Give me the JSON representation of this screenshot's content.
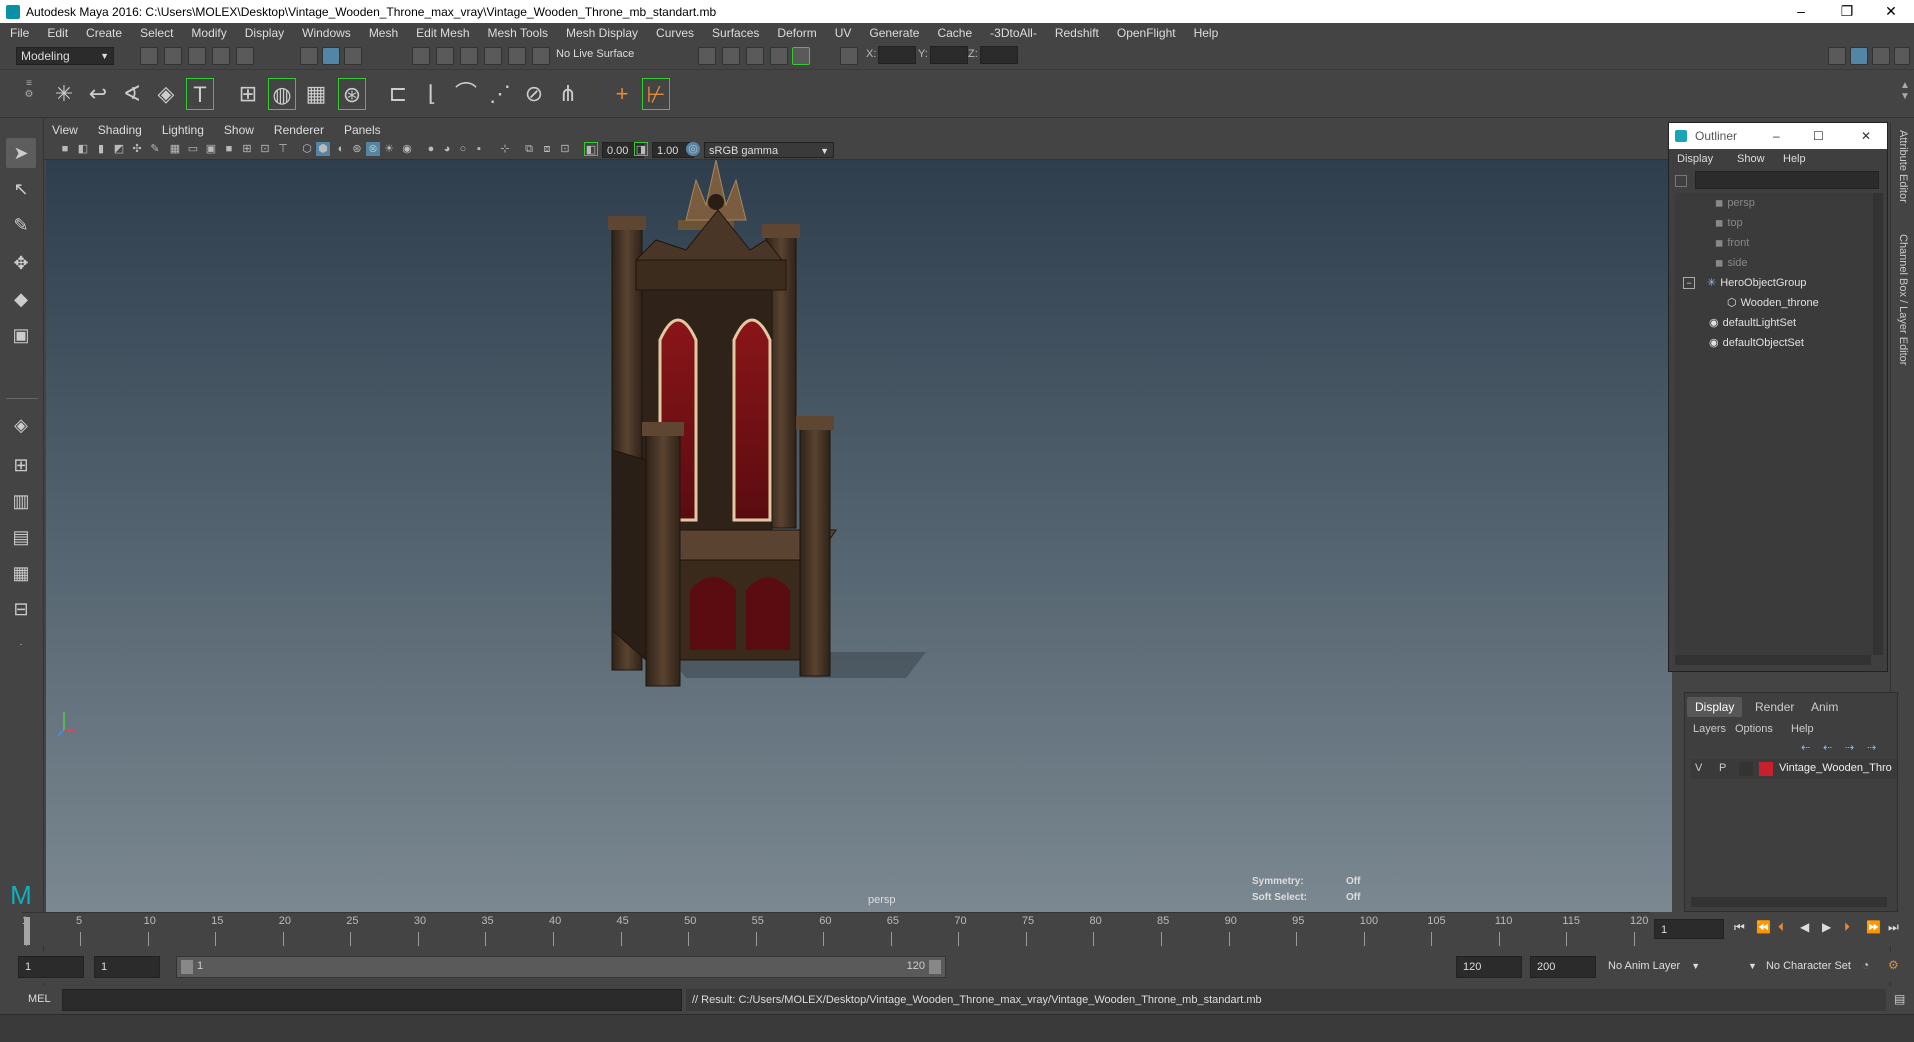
{
  "window": {
    "title": "Autodesk Maya 2016: C:\\Users\\MOLEX\\Desktop\\Vintage_Wooden_Throne_max_vray\\Vintage_Wooden_Throne_mb_standart.mb",
    "controls": [
      "–",
      "❐",
      "✕"
    ]
  },
  "menubar": [
    "File",
    "Edit",
    "Create",
    "Select",
    "Modify",
    "Display",
    "Windows",
    "Mesh",
    "Edit Mesh",
    "Mesh Tools",
    "Mesh Display",
    "Curves",
    "Surfaces",
    "Deform",
    "UV",
    "Generate",
    "Cache",
    "-3DtoAll-",
    "Redshift",
    "OpenFlight",
    "Help"
  ],
  "status_line": {
    "mode": "Modeling",
    "live_surface": "No Live Surface",
    "coord_labels": [
      "X:",
      "Y:",
      "Z:"
    ]
  },
  "viewport": {
    "menu": [
      "View",
      "Shading",
      "Lighting",
      "Show",
      "Renderer",
      "Panels"
    ],
    "exposure": "0.00",
    "gamma": "1.00",
    "color_space": "sRGB gamma",
    "camera_label": "persp",
    "hud": [
      {
        "label": "Symmetry:",
        "value": "Off"
      },
      {
        "label": "Soft Select:",
        "value": "Off"
      }
    ]
  },
  "outliner": {
    "title": "Outliner",
    "menu": [
      "Display",
      "Show",
      "Help"
    ],
    "items": [
      {
        "label": "persp",
        "icon": "camera-icon",
        "dim": true
      },
      {
        "label": "top",
        "icon": "camera-icon",
        "dim": true
      },
      {
        "label": "front",
        "icon": "camera-icon",
        "dim": true
      },
      {
        "label": "side",
        "icon": "camera-icon",
        "dim": true
      },
      {
        "label": "HeroObjectGroup",
        "icon": "group-icon",
        "dim": false
      },
      {
        "label": "Wooden_throne",
        "icon": "mesh-icon",
        "dim": false
      },
      {
        "label": "defaultLightSet",
        "icon": "set-icon",
        "dim": false
      },
      {
        "label": "defaultObjectSet",
        "icon": "set-icon",
        "dim": false
      }
    ]
  },
  "layer_editor": {
    "tabs": [
      "Display",
      "Render",
      "Anim"
    ],
    "menu": [
      "Layers",
      "Options",
      "Help"
    ],
    "layer": {
      "v": "V",
      "p": "P",
      "name": "Vintage_Wooden_Thro",
      "color": "#c8202a"
    }
  },
  "side_tabs": [
    "Attribute Editor",
    "Channel Box / Layer Editor"
  ],
  "timeline": {
    "ticks": [
      1,
      5,
      10,
      15,
      20,
      25,
      30,
      35,
      40,
      45,
      50,
      55,
      60,
      65,
      70,
      75,
      80,
      85,
      90,
      95,
      100,
      105,
      110,
      115,
      120
    ],
    "current_frame": "1"
  },
  "range": {
    "start": "1",
    "playback_start": "1",
    "slider_start": "1",
    "slider_end": "120",
    "playback_end": "120",
    "end": "200",
    "anim_layer": "No Anim Layer",
    "character_set": "No Character Set"
  },
  "command_line": {
    "lang": "MEL",
    "result": "// Result: C:/Users/MOLEX/Desktop/Vintage_Wooden_Throne_max_vray/Vintage_Wooden_Throne_mb_standart.mb"
  },
  "colors": {
    "accent": "#5285a6",
    "layer_red": "#c8202a",
    "maya_teal": "#0a8fa8"
  }
}
